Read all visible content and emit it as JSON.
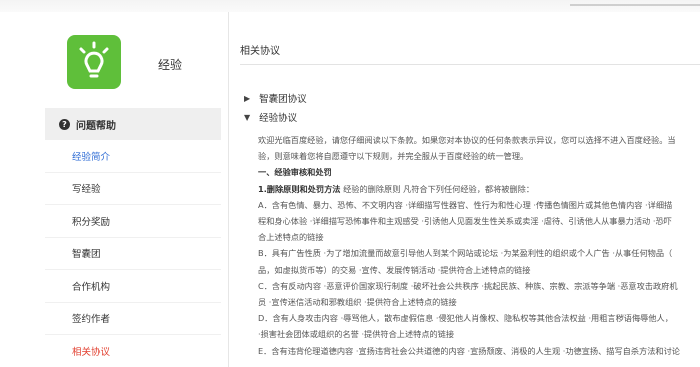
{
  "brand": {
    "title": "经验",
    "logo_icon": "lightbulb-icon",
    "logo_color": "#5fbf3a"
  },
  "sidebar": {
    "header": {
      "icon": "question-circle-icon",
      "label": "问题帮助"
    },
    "items": [
      {
        "label": "经验简介",
        "state": "blue"
      },
      {
        "label": "写经验",
        "state": ""
      },
      {
        "label": "积分奖励",
        "state": ""
      },
      {
        "label": "智囊团",
        "state": ""
      },
      {
        "label": "合作机构",
        "state": ""
      },
      {
        "label": "签约作者",
        "state": ""
      },
      {
        "label": "相关协议",
        "state": "red"
      }
    ]
  },
  "main": {
    "title": "相关协议",
    "sections": [
      {
        "label": "智囊团协议",
        "arrow": "▶"
      },
      {
        "label": "经验协议",
        "arrow": "▼"
      }
    ],
    "content": {
      "intro1": "欢迎光临百度经验，请您仔细阅读以下条款。如果您对本协议的任何条款表示异议，您可以选择不进入百度经验。当",
      "intro2": "验，则意味着您将自愿遵守以下规则，并完全服从于百度经验的统一管理。",
      "heading": "一、经验审核和处罚",
      "rule_title": "1.删除原则和处罚方法",
      "rule_text": " 经验的删除原则 凡符合下列任何经验，都将被删除：",
      "line_a1": "A．含有色情、暴力、恐怖、不文明内容 ·详细描写性器官、性行为和性心理 ·传播色情图片或其他色情内容 ·详细描",
      "line_a2": "程和身心体验 ·详细描写恐怖事件和主观感受 ·引诱他人见面发生性关系或卖淫 ·虐待、引诱他人从事暴力活动 ·恐吓",
      "line_a3": "合上述特点的链接",
      "line_b1": "B．具有广告性质 ·为了增加流量而故意引导他人到某个网站或论坛 ·为某盈利性的组织或个人广告 ·从事任何物品（",
      "line_b2": "品，如虚拟货币等）的交易 ·宣传、发展传销活动 ·提供符合上述特点的链接",
      "line_c1": "C．含有反动内容 ·恶意评价国家现行制度 ·破坏社会公共秩序 ·挑起民族、种族、宗教、宗派等争端 ·恶意攻击政府机",
      "line_c2": "员 ·宣传迷信活动和邪教组织 ·提供符合上述特点的链接",
      "line_d1": "D．含有人身攻击内容 ·辱骂他人，散布虚假信息 ·侵犯他人肖像权、隐私权等其他合法权益 ·用粗言秽语侮辱他人，",
      "line_d2": "·损害社会团体或组织的名誉 ·提供符合上述特点的链接",
      "line_e1": "E．含有违背伦理道德内容 ·宣扬违背社会公共道德的内容 ·宣扬颓废、消极的人生观 ·功德宣扬、描写自杀方法和讨论"
    }
  }
}
